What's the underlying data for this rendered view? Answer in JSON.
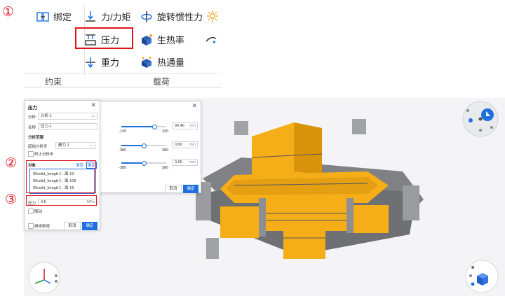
{
  "markers": [
    "①",
    "②",
    "③"
  ],
  "ribbon": {
    "bind_label": "绑定",
    "force_moment_label": "力/力矩",
    "rotational_inertia_label": "旋转惯性力",
    "pressure_label": "压力",
    "heat_gen_label": "生热率",
    "gravity_label": "重力",
    "heat_flux_label": "热通量",
    "constraint_group": "约束",
    "load_group": "载荷"
  },
  "pressure_dialog": {
    "title": "压力",
    "analysis_label": "分析",
    "analysis_value": "分析-1",
    "name_label": "名称",
    "name_value": "压力-1",
    "range_title": "分析范围",
    "start_step_label": "起始分析步",
    "start_step_value": "静力-1",
    "terminate_label": "终止分析步",
    "object_label": "对象",
    "clear_label": "清空",
    "confirm_small": "确定",
    "objects": [
      "09solid_bengti-1 : 面-10",
      "09solid_bengti-1 : 面-109",
      "09solid_bengti-1 : 面-16"
    ],
    "pressure_label": "压力",
    "pressure_value": "4.5",
    "pressure_unit": "MPa",
    "follow_label": "随动",
    "continue_label": "继续新增",
    "cancel_label": "取消",
    "ok_label": "确定"
  },
  "back_dialog": {
    "cancel_label": "取消",
    "ok_label": "确定",
    "rows": [
      {
        "min": "-149",
        "max": "330",
        "value": "90.46",
        "unit": "mm",
        "fraction": 0.74
      },
      {
        "min": "-380",
        "max": "380",
        "value": "0.00",
        "unit": "mm",
        "fraction": 0.5
      },
      {
        "min": "-380",
        "max": "380",
        "value": "0.00",
        "unit": "mm",
        "fraction": 0.5
      }
    ]
  },
  "colors": {
    "accent": "#1f6fe0",
    "marker_red": "#e0141e",
    "part_orange": "#f5ae17",
    "part_gray": "#8a8c90"
  }
}
